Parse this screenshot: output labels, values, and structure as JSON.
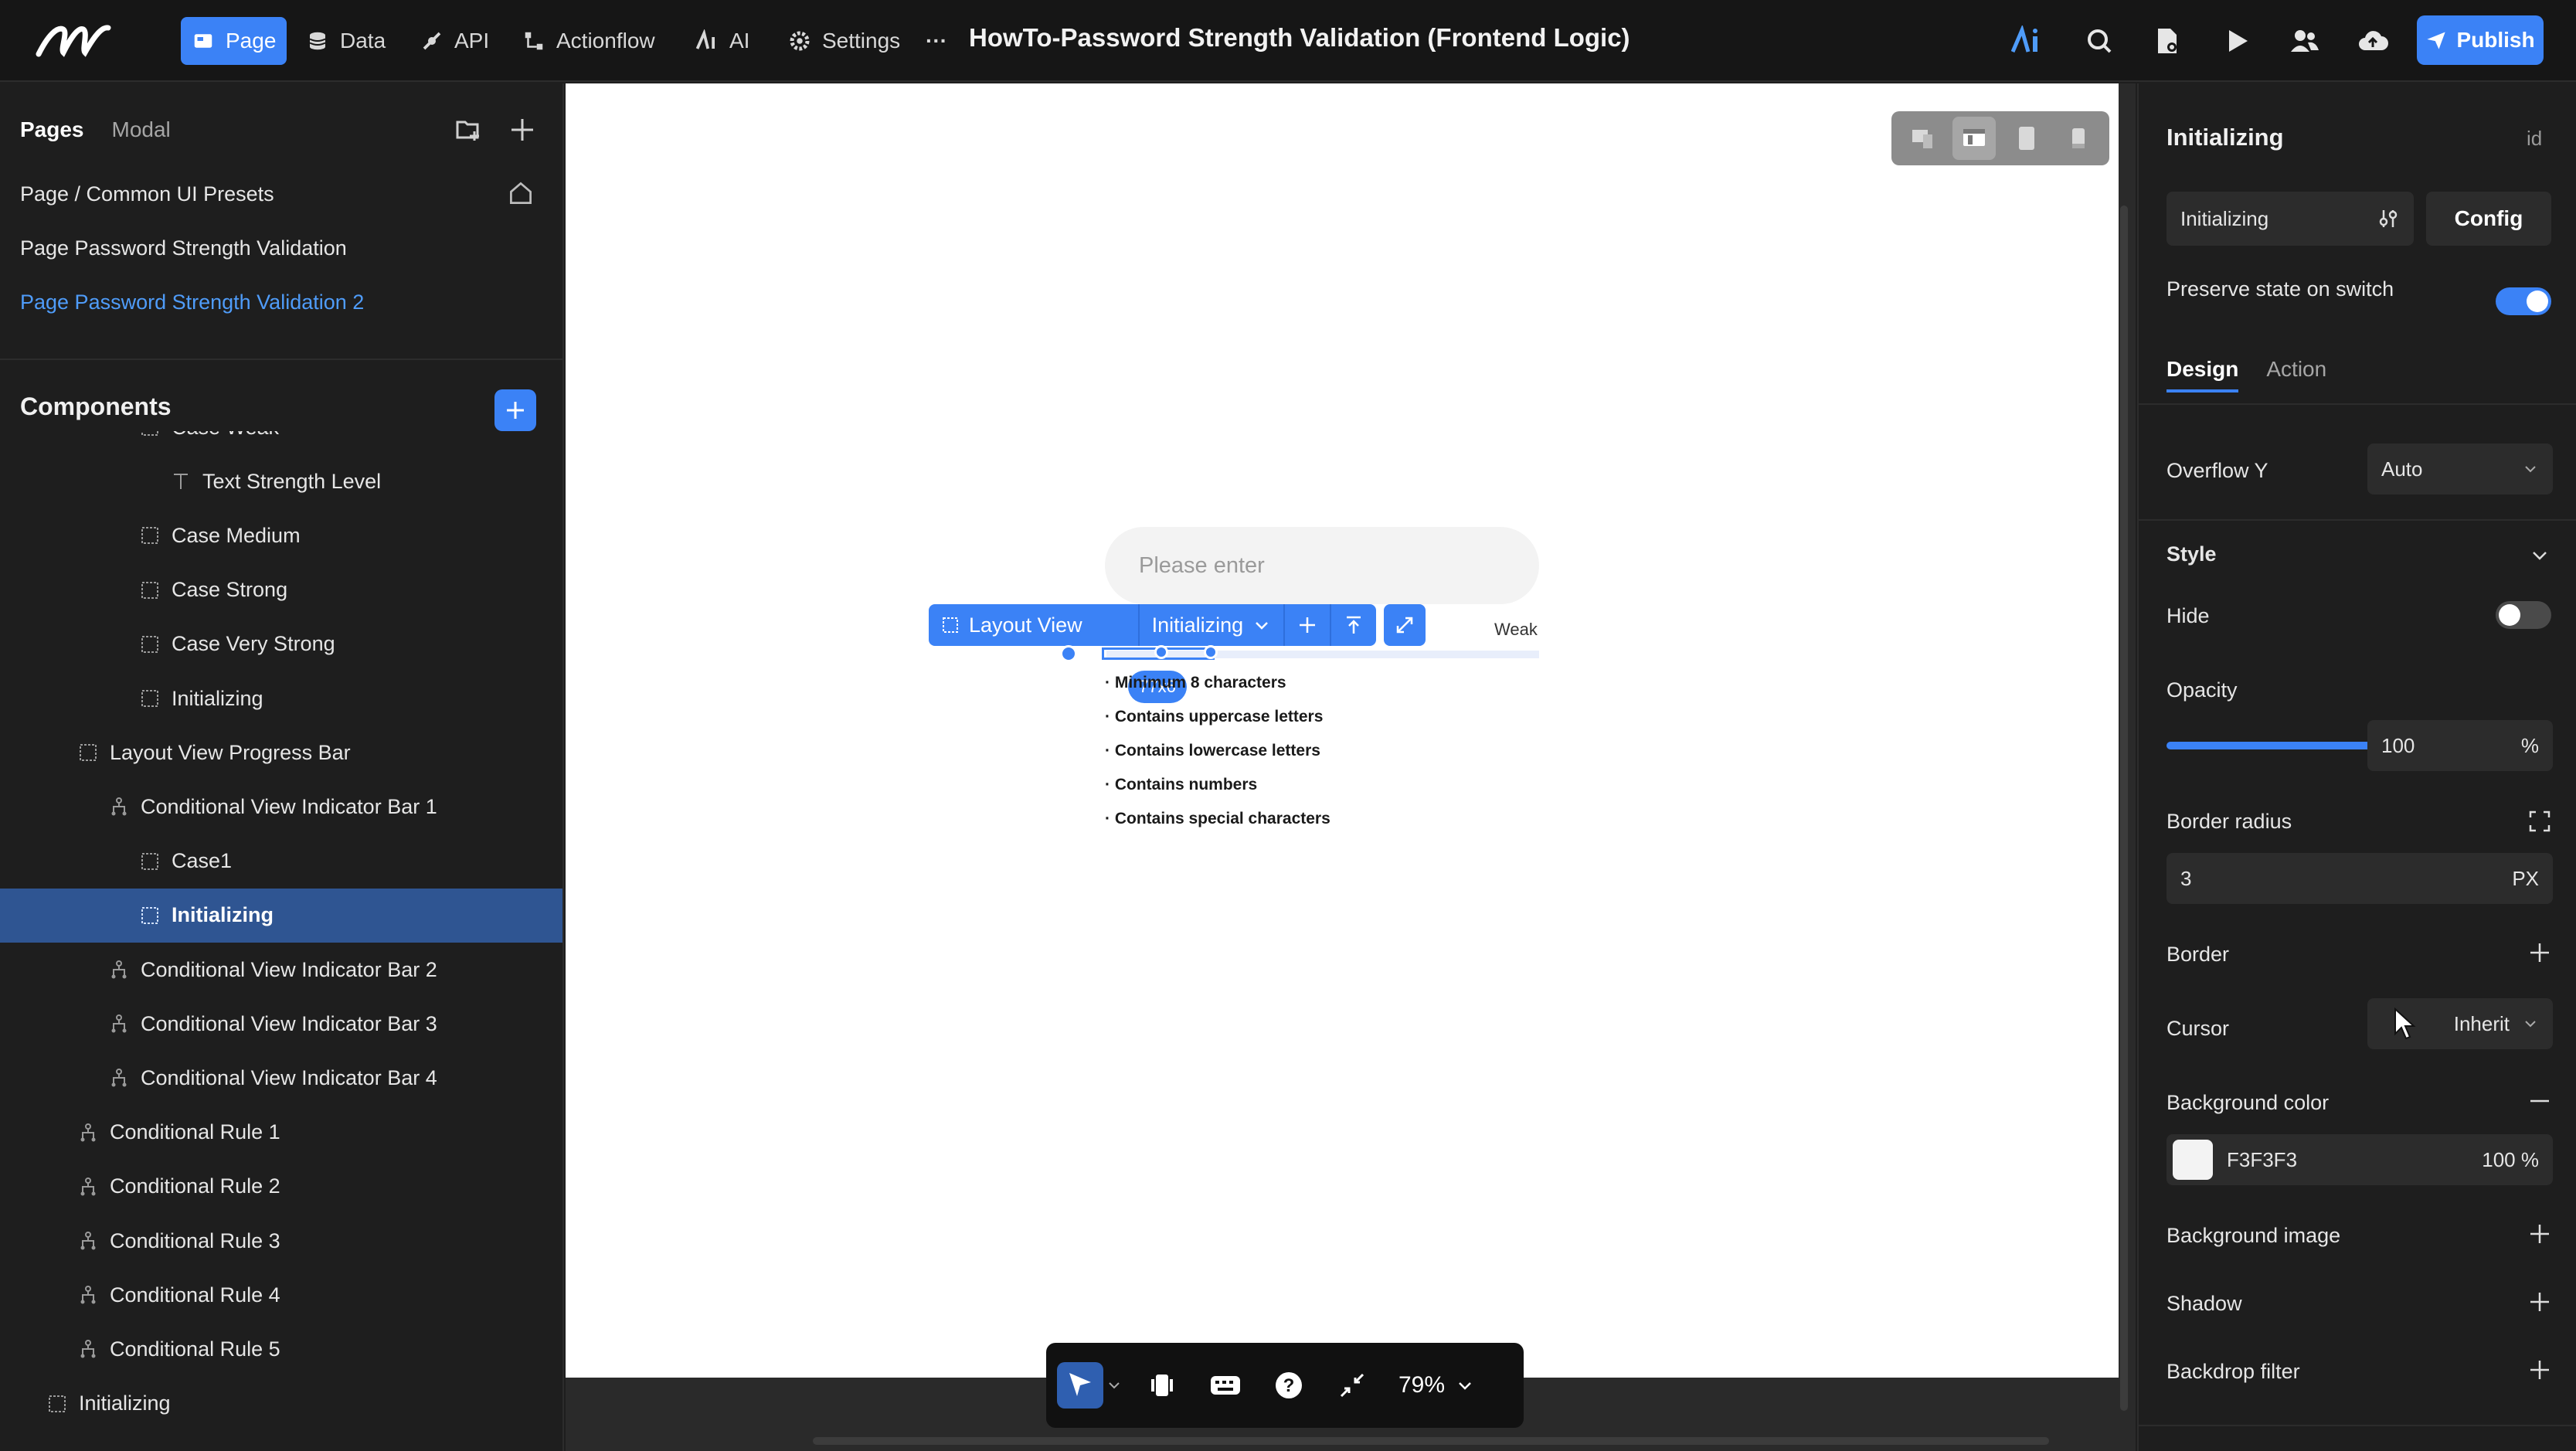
{
  "topbar": {
    "nav": [
      {
        "label": "Page",
        "icon": "page-icon",
        "active": true
      },
      {
        "label": "Data",
        "icon": "database-icon"
      },
      {
        "label": "API",
        "icon": "api-icon"
      },
      {
        "label": "Actionflow",
        "icon": "flow-icon"
      },
      {
        "label": "AI",
        "icon": "ai-icon"
      },
      {
        "label": "Settings",
        "icon": "gear-icon"
      }
    ],
    "more": "···",
    "title": "HowTo-Password Strength Validation (Frontend Logic)",
    "publish_label": "Publish",
    "accent": "#3b82f6"
  },
  "left": {
    "tab_pages": "Pages",
    "tab_modal": "Modal",
    "pages": [
      "Page / Common UI Presets",
      "Page Password Strength Validation",
      "Page Password Strength Validation 2"
    ],
    "components_title": "Components",
    "tree": [
      {
        "label": "Case Weak",
        "indent": 4,
        "icon": "view-icon"
      },
      {
        "label": "Text Strength Level",
        "indent": 5,
        "icon": "text-icon"
      },
      {
        "label": "Case Medium",
        "indent": 4,
        "icon": "view-icon"
      },
      {
        "label": "Case Strong",
        "indent": 4,
        "icon": "view-icon"
      },
      {
        "label": "Case Very Strong",
        "indent": 4,
        "icon": "view-icon"
      },
      {
        "label": "Initializing",
        "indent": 4,
        "icon": "view-icon"
      },
      {
        "label": "Layout View Progress Bar",
        "indent": 2,
        "icon": "view-icon"
      },
      {
        "label": "Conditional View Indicator Bar 1",
        "indent": 3,
        "icon": "conditional-icon"
      },
      {
        "label": "Case1",
        "indent": 4,
        "icon": "view-icon"
      },
      {
        "label": "Initializing",
        "indent": 4,
        "icon": "view-icon",
        "selected": true
      },
      {
        "label": "Conditional View Indicator Bar 2",
        "indent": 3,
        "icon": "conditional-icon"
      },
      {
        "label": "Conditional View Indicator Bar 3",
        "indent": 3,
        "icon": "conditional-icon"
      },
      {
        "label": "Conditional View Indicator Bar 4",
        "indent": 3,
        "icon": "conditional-icon"
      },
      {
        "label": "Conditional Rule 1",
        "indent": 2,
        "icon": "conditional-icon"
      },
      {
        "label": "Conditional Rule 2",
        "indent": 2,
        "icon": "conditional-icon"
      },
      {
        "label": "Conditional Rule 3",
        "indent": 2,
        "icon": "conditional-icon"
      },
      {
        "label": "Conditional Rule 4",
        "indent": 2,
        "icon": "conditional-icon"
      },
      {
        "label": "Conditional Rule 5",
        "indent": 2,
        "icon": "conditional-icon"
      },
      {
        "label": "Initializing",
        "indent": 1,
        "icon": "view-icon"
      }
    ]
  },
  "canvas": {
    "input_placeholder": "Please enter",
    "toolbar": {
      "component": "Layout View",
      "state": "Initializing"
    },
    "weak_label": "Weak",
    "size_badge": "77x6",
    "requirements": [
      "· Minimum 8 characters",
      "· Contains uppercase letters",
      "· Contains lowercase letters",
      "· Contains numbers",
      "· Contains special characters"
    ],
    "zoom": "79%"
  },
  "right": {
    "title": "Initializing",
    "id_label": "id",
    "state_value": "Initializing",
    "config_label": "Config",
    "preserve_label": "Preserve state on switch",
    "preserve_on": true,
    "tab_design": "Design",
    "tab_action": "Action",
    "overflow_label": "Overflow Y",
    "overflow_value": "Auto",
    "style_label": "Style",
    "hide_label": "Hide",
    "hide_on": false,
    "opacity_label": "Opacity",
    "opacity_value": "100",
    "opacity_unit": "%",
    "opacity_level": 1.0,
    "radius_label": "Border radius",
    "radius_value": "3",
    "radius_unit": "PX",
    "border_label": "Border",
    "cursor_label": "Cursor",
    "cursor_value": "Inherit",
    "bg_label": "Background color",
    "bg_hex": "F3F3F3",
    "bg_swatch": "#F3F3F3",
    "bg_alpha": "100",
    "bg_alpha_unit": "%",
    "bgimg_label": "Background image",
    "shadow_label": "Shadow",
    "backdrop_label": "Backdrop filter"
  }
}
